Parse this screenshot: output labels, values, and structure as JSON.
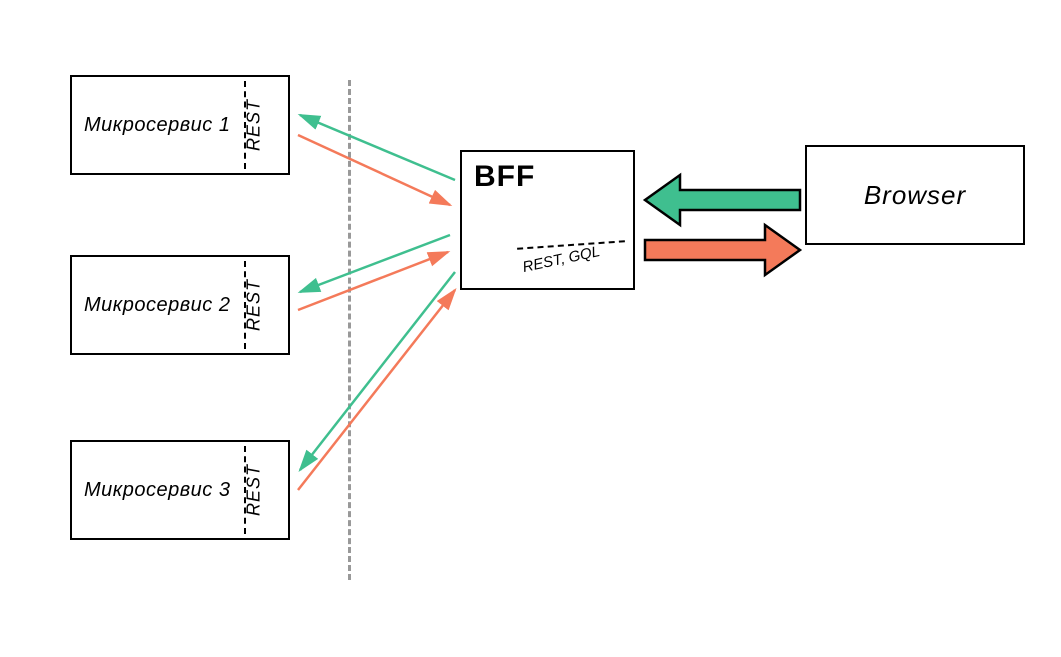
{
  "microservices": [
    {
      "label": "Микросервис 1",
      "api": "REST"
    },
    {
      "label": "Микросервис 2",
      "api": "REST"
    },
    {
      "label": "Микросервис 3",
      "api": "REST"
    }
  ],
  "bff": {
    "title": "BFF",
    "api": "REST, GQL"
  },
  "browser": {
    "label": "Browser"
  },
  "colors": {
    "request": "#3fbf8f",
    "response": "#f47a5a",
    "boundary": "#999999"
  },
  "arrows": {
    "bff_to_ms": [
      {
        "from": "bff",
        "to": "microservice-1",
        "type": "request"
      },
      {
        "from": "microservice-1",
        "to": "bff",
        "type": "response"
      },
      {
        "from": "bff",
        "to": "microservice-2",
        "type": "request"
      },
      {
        "from": "microservice-2",
        "to": "bff",
        "type": "response"
      },
      {
        "from": "bff",
        "to": "microservice-3",
        "type": "request"
      },
      {
        "from": "microservice-3",
        "to": "bff",
        "type": "response"
      }
    ],
    "browser_to_bff": [
      {
        "from": "browser",
        "to": "bff",
        "type": "request",
        "style": "thick"
      },
      {
        "from": "bff",
        "to": "browser",
        "type": "response",
        "style": "thick"
      }
    ]
  }
}
